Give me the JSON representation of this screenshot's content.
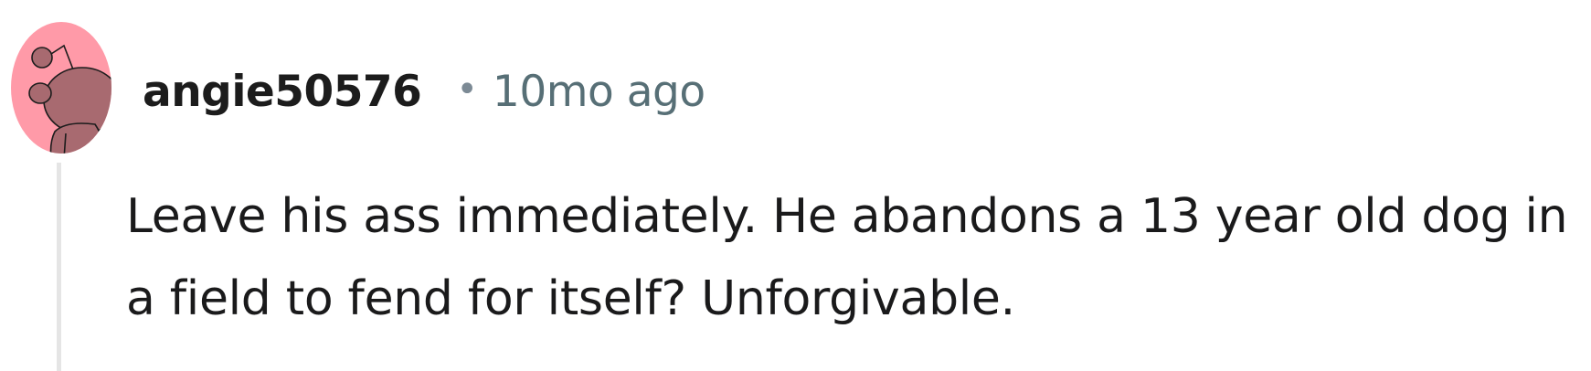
{
  "comment": {
    "username": "angie50576",
    "separator": "•",
    "timestamp": "10mo ago",
    "body": "Leave his ass immediately. He abandons a 13 year old dog in a field to fend for itself? Unforgivable."
  },
  "avatar": {
    "icon": "snoo-avatar-icon",
    "background_color": "#ff9aa8",
    "figure_color": "#a86a70"
  },
  "colors": {
    "username": "#1c1c1c",
    "timestamp": "#576f76",
    "body_text": "#1a1a1b",
    "thread_line": "#e5e5e5"
  }
}
